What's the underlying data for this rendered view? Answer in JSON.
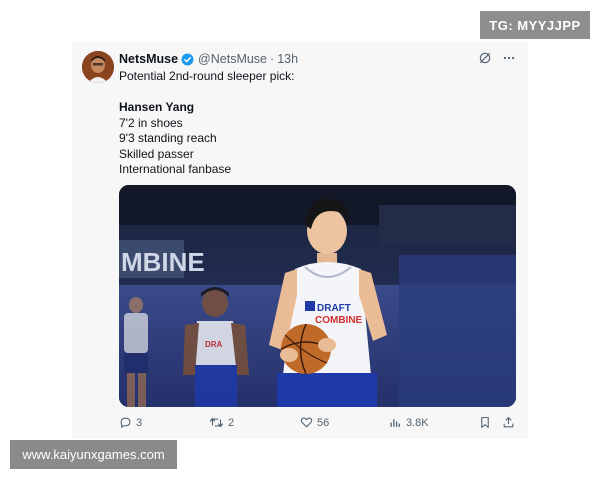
{
  "overlay": {
    "badge": "TG: MYYJJPP",
    "watermark": "www.kaiyunxgames.com"
  },
  "tweet": {
    "display_name": "NetsMuse",
    "handle": "@NetsMuse",
    "separator": "·",
    "time": "13h",
    "verified": true,
    "lines": [
      "Potential 2nd-round sleeper pick:",
      "Hansen Yang",
      "7'2 in shoes",
      "9'3 standing reach",
      "Skilled passer",
      "International fanbase"
    ],
    "media": {
      "jersey_text_1": "DRAFT",
      "jersey_text_2": "COMBINE",
      "banner_text": "MBINE"
    },
    "actions": {
      "replies": "3",
      "retweets": "2",
      "likes": "56",
      "views": "3.8K"
    },
    "icons": [
      "grok-icon",
      "more-icon",
      "reply-icon",
      "retweet-icon",
      "like-icon",
      "views-icon",
      "bookmark-icon",
      "share-icon"
    ]
  },
  "colors": {
    "verified": "#1d9bf0",
    "muted": "#536471",
    "jersey_text": "#d32f2f",
    "court": "#1c2540"
  }
}
